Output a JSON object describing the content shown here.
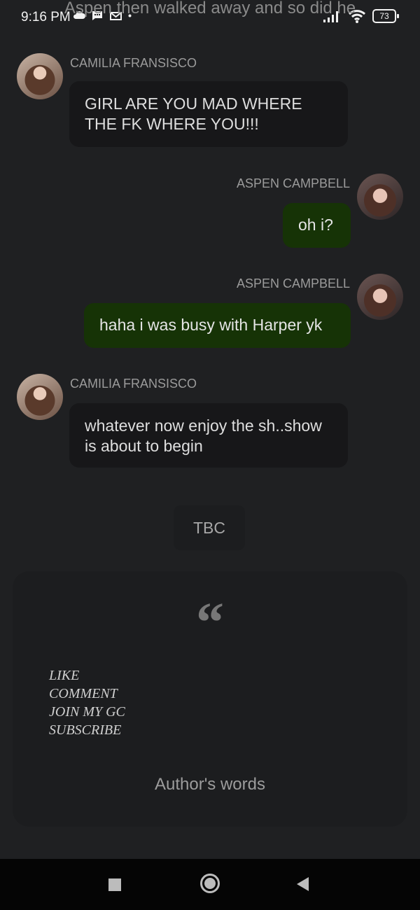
{
  "status_bar": {
    "time": "9:16 PM",
    "left_icons": [
      "cloud-icon",
      "message-icon",
      "gmail-icon",
      "dot-icon"
    ],
    "right_icons": [
      "signal-icon",
      "wifi-icon",
      "battery-icon"
    ],
    "battery_level": "73"
  },
  "top_caption": "Aspen then walked away and so did he",
  "messages": [
    {
      "sender": "CAMILIA FRANSISCO",
      "text": "GIRL ARE YOU MAD WHERE THE FK WHERE YOU!!!",
      "side": "left"
    },
    {
      "sender": "ASPEN CAMPBELL",
      "text": "oh i?",
      "side": "right"
    },
    {
      "sender": "ASPEN CAMPBELL",
      "text": "haha i was busy with Harper yk",
      "side": "right"
    },
    {
      "sender": "CAMILIA FRANSISCO",
      "text": "whatever now enjoy the sh..show is about to begin",
      "side": "left"
    }
  ],
  "tbc_label": "TBC",
  "author_card": {
    "quote_mark": "“",
    "lines": [
      "LIKE",
      "COMMENT",
      "JOIN MY GC",
      "SUBSCRIBE"
    ],
    "label": "Author's words"
  },
  "navigation": {
    "items": [
      "recent-apps-button",
      "home-button",
      "back-button"
    ]
  },
  "colors": {
    "background": "#1f2022",
    "dark_bubble": "#171719",
    "green_bubble": "#163306",
    "nav_background": "#050505"
  }
}
